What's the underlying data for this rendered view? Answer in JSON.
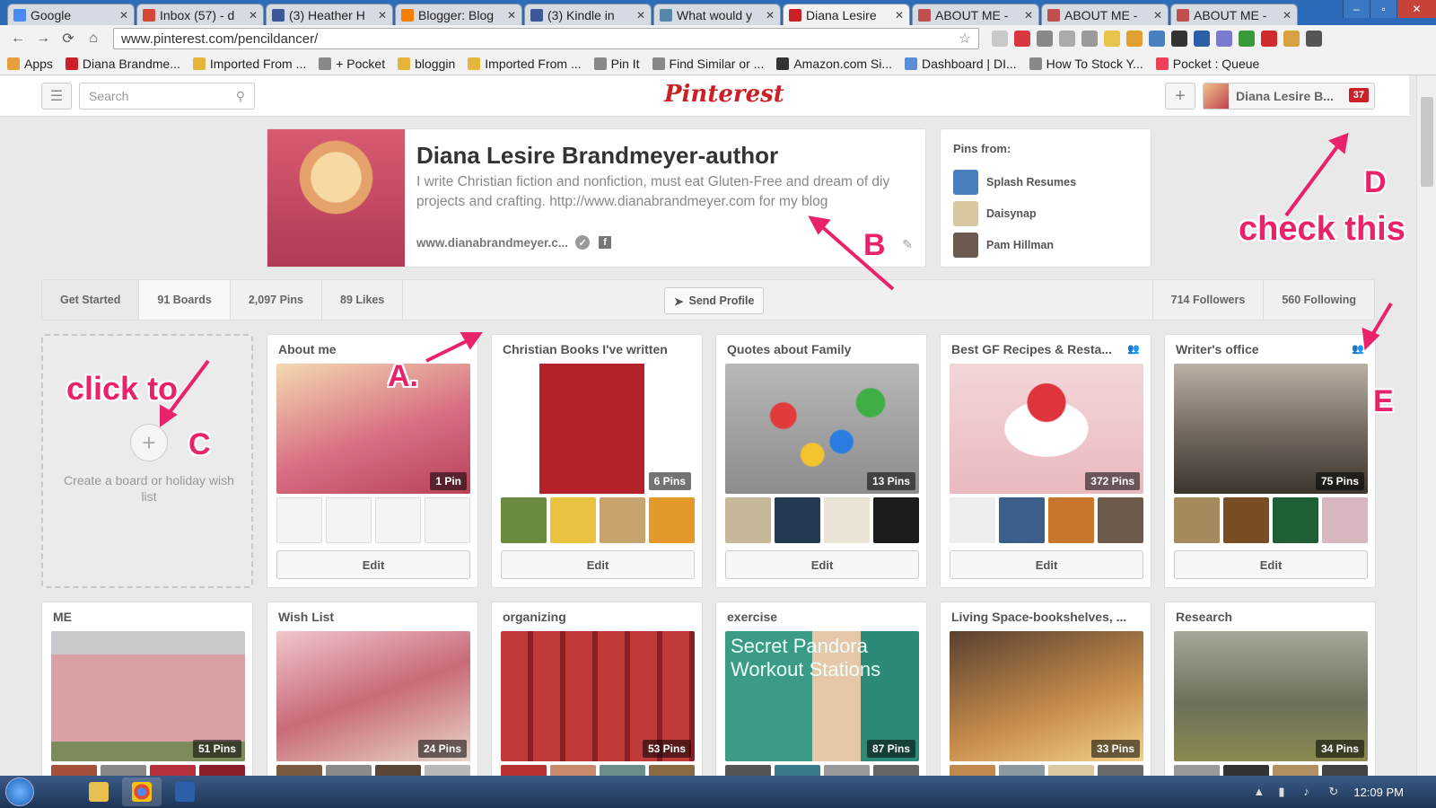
{
  "browser": {
    "tabs": [
      {
        "label": "Google",
        "color": "#4a8af4"
      },
      {
        "label": "Inbox (57) - d",
        "color": "#d44638"
      },
      {
        "label": "(3) Heather H",
        "color": "#3b5998"
      },
      {
        "label": "Blogger: Blog",
        "color": "#f57d00"
      },
      {
        "label": "(3) Kindle in",
        "color": "#3b5998"
      },
      {
        "label": "What would y",
        "color": "#58a"
      },
      {
        "label": "Diana Lesire",
        "color": "#cb2027"
      },
      {
        "label": "ABOUT ME -",
        "color": "#c0504f"
      },
      {
        "label": "ABOUT ME -",
        "color": "#c0504f"
      },
      {
        "label": "ABOUT ME -",
        "color": "#c0504f"
      }
    ],
    "url": "www.pinterest.com/pencildancer/",
    "bookmarks": [
      {
        "label": "Apps",
        "color": "#e6a03c"
      },
      {
        "label": "Diana Brandme...",
        "color": "#cb2027"
      },
      {
        "label": "Imported From ...",
        "color": "#e6b53c"
      },
      {
        "label": "+ Pocket",
        "color": "#888"
      },
      {
        "label": "bloggin",
        "color": "#e6b53c"
      },
      {
        "label": "Imported From ...",
        "color": "#e6b53c"
      },
      {
        "label": "Pin It",
        "color": "#888"
      },
      {
        "label": "Find Similar or ...",
        "color": "#888"
      },
      {
        "label": "Amazon.com Si...",
        "color": "#333"
      },
      {
        "label": "Dashboard | DI...",
        "color": "#5a8fd6"
      },
      {
        "label": "How To Stock Y...",
        "color": "#888"
      },
      {
        "label": "Pocket : Queue",
        "color": "#ee4056"
      }
    ]
  },
  "header": {
    "search_placeholder": "Search",
    "logo": "Pinterest",
    "user_name": "Diana Lesire B...",
    "notifications": "37"
  },
  "profile": {
    "name": "Diana Lesire Brandmeyer-author",
    "bio": "I write Christian fiction and nonfiction, must eat Gluten-Free and dream of diy projects and crafting. http://www.dianabrandmeyer.com for my blog",
    "website": "www.dianabrandmeyer.c..."
  },
  "pins_from": {
    "header": "Pins from:",
    "items": [
      {
        "name": "Splash Resumes",
        "color": "#4a7fc0"
      },
      {
        "name": "Daisynap",
        "color": "#d9c7a0"
      },
      {
        "name": "Pam Hillman",
        "color": "#6a5a50"
      }
    ]
  },
  "stats": {
    "get_started": "Get Started",
    "boards": "91 Boards",
    "pins": "2,097 Pins",
    "likes": "89 Likes",
    "send_profile": "Send Profile",
    "followers": "714 Followers",
    "following": "560 Following"
  },
  "create_board": {
    "text": "Create a board or holiday wish list"
  },
  "edit_label": "Edit",
  "boards": [
    {
      "title": "About me",
      "count": "1 Pin",
      "cover": "linear-gradient(160deg,#f3d9b0,#d86e83 55%,#b8425a)",
      "thumbs": [
        "empty",
        "empty",
        "empty",
        "empty"
      ],
      "group": false
    },
    {
      "title": "Christian Books I've written",
      "count": "6 Pins",
      "cover": "linear-gradient(90deg,#fff 0 20%,#b5212b 20% 74%,#fff 74%)",
      "thumbs": [
        "#6c8a3f",
        "#e9c23f",
        "#c9a36e",
        "#e49a2b"
      ],
      "group": false
    },
    {
      "title": "Quotes about Family",
      "count": "13 Pins",
      "cover": "radial-gradient(circle at 30% 40%,#e23b3b 0 8%,transparent 9%),radial-gradient(circle at 60% 60%,#2a7de0 0 8%,transparent 9%),radial-gradient(circle at 75% 30%,#3fae45 0 8%,transparent 9%),radial-gradient(circle at 45% 70%,#f2c22f 0 8%,transparent 9%),linear-gradient(#b8b8b8,#8c8c8c)",
      "thumbs": [
        "#c7b79b",
        "#233a52",
        "#e9e4d6",
        "#1b1b1b"
      ],
      "group": false
    },
    {
      "title": "Best GF Recipes & Resta...",
      "count": "372 Pins",
      "cover": "radial-gradient(circle at 50% 30%,#e0343c 0 14%,transparent 15%),radial-gradient(ellipse at 50% 50%,#fff 0 30%,transparent 31%),linear-gradient(180deg,#f3d6d9,#e9b9bf)",
      "thumbs": [
        "#eeeeee",
        "#3b5f8a",
        "#c8762c",
        "#6e5a4b"
      ],
      "group": true
    },
    {
      "title": "Writer's office",
      "count": "75 Pins",
      "cover": "linear-gradient(180deg,#b9b1a4,#6f675c 55%,#3d362e)",
      "thumbs": [
        "#a48a5c",
        "#7a4e24",
        "#1f5f36",
        "#d9b7bf"
      ],
      "group": true
    },
    {
      "title": "ME",
      "count": "51 Pins",
      "cover": "linear-gradient(180deg,#c7c9cc 0 18%,#d9a1a4 18% 85%,#7d8a5a 85%)",
      "thumbs": [
        "#a5503b",
        "#888",
        "#b5303b",
        "#8b1f2c"
      ],
      "group": false
    },
    {
      "title": "Wish List",
      "count": "24 Pins",
      "cover": "linear-gradient(160deg,#f0c7cc,#c96a78 50%,#e7d5c9)",
      "thumbs": [
        "#7a5a40",
        "#8a8a8a",
        "#5a4636",
        "#b9b9b9"
      ],
      "group": false
    },
    {
      "title": "organizing",
      "count": "53 Pins",
      "cover": "repeating-linear-gradient(90deg,#c13a3a 0 30px,#8b1d24 30px 36px)",
      "thumbs": [
        "#b83232",
        "#c98a6b",
        "#6a8f8a",
        "#8a6a40"
      ],
      "group": false
    },
    {
      "title": "exercise",
      "count": "87 Pins",
      "cover": "linear-gradient(90deg,#3c9b86 0 45%,#e7c7a9 45% 70%,#2d8a78 70%)",
      "thumbs": [
        "#555",
        "#3a7a8a",
        "#999",
        "#666"
      ],
      "group": false
    },
    {
      "title": "Living Space-bookshelves, ...",
      "count": "33 Pins",
      "cover": "linear-gradient(160deg,#5a4030,#c98f4c 60%,#f1d28a)",
      "thumbs": [
        "#c08a4f",
        "#8a9aa0",
        "#d9c8a0",
        "#6a6a6a"
      ],
      "group": false
    },
    {
      "title": "Research",
      "count": "34 Pins",
      "cover": "linear-gradient(180deg,#a8a89a,#6e6e5c 55%,#8a8a50)",
      "thumbs": [
        "#999",
        "#333",
        "#b09060",
        "#444"
      ],
      "group": false
    }
  ],
  "exercise_cover_text": "Secret Pandora Workout Stations",
  "annotations": {
    "a": "A.",
    "b": "B",
    "c": "C",
    "d": "D",
    "e": "E",
    "click_to": "click to",
    "check_this": "check this"
  },
  "taskbar": {
    "time": "12:09 PM"
  }
}
